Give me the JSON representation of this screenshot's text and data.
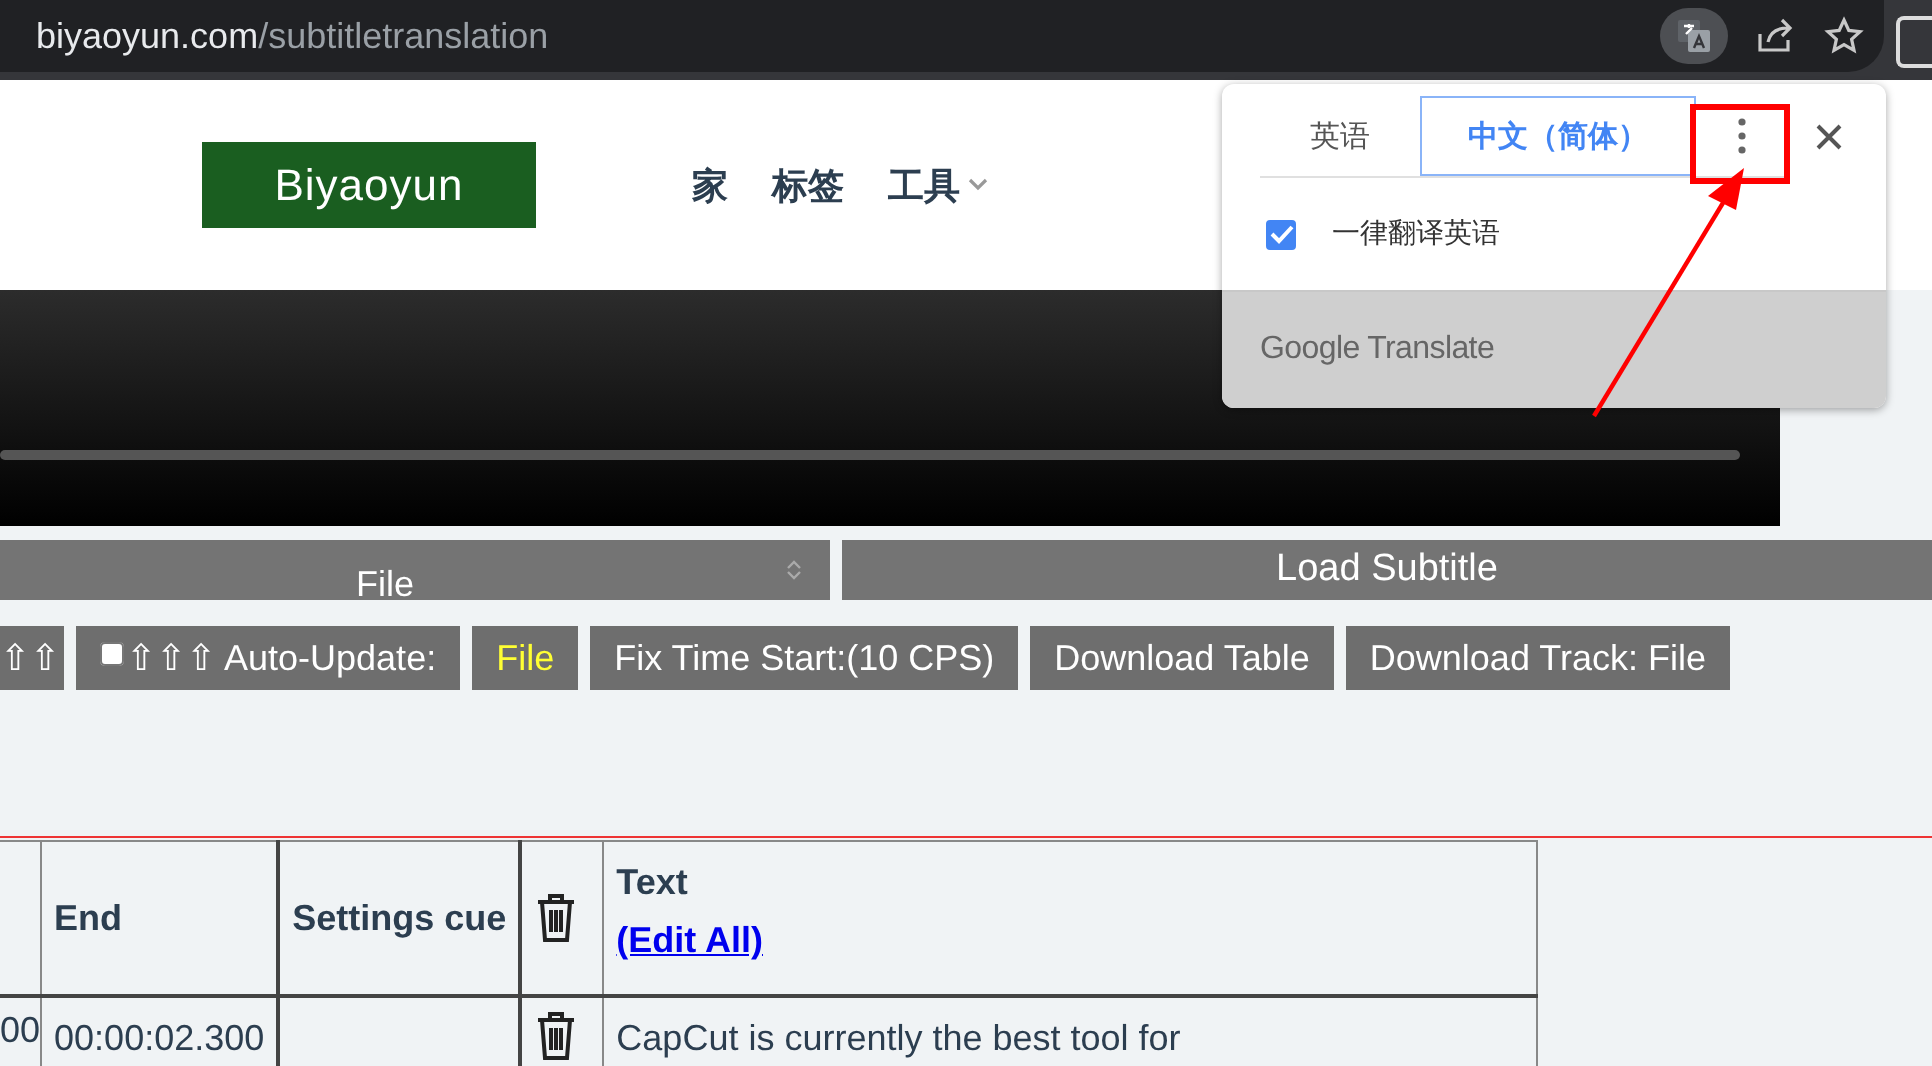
{
  "browser": {
    "address_domain": "biyaoyun.com",
    "address_path": "/subtitletranslation"
  },
  "site": {
    "logo": "Biyaoyun",
    "nav": [
      {
        "label": "家",
        "dropdown": false
      },
      {
        "label": "标签",
        "dropdown": false
      },
      {
        "label": "工具",
        "dropdown": true
      }
    ]
  },
  "file_select": {
    "value": "File"
  },
  "load_button": "Load Subtitle",
  "toolbar": [
    {
      "kind": "button",
      "label": "⇧⇧"
    },
    {
      "kind": "checkbox",
      "label": "⇧⇧⇧ Auto-Update:",
      "checked": false
    },
    {
      "kind": "accent",
      "label": "File"
    },
    {
      "kind": "button",
      "label": "Fix Time Start:(10 CPS)"
    },
    {
      "kind": "button",
      "label": "Download Table"
    },
    {
      "kind": "button",
      "label": "Download Track: File"
    }
  ],
  "table": {
    "columns": [
      {
        "kind": "cut"
      },
      {
        "kind": "text",
        "label": "End"
      },
      {
        "kind": "text",
        "label": "Settings cue"
      },
      {
        "kind": "delete"
      },
      {
        "kind": "text",
        "label": "Text",
        "link": "(Edit All)"
      }
    ],
    "rows": [
      {
        "column_1": "00",
        "end": "00:00:02.300",
        "text": "CapCut is currently the best tool for"
      }
    ]
  },
  "translate_popup": {
    "tabs": [
      {
        "label": "英语",
        "selected": false
      },
      {
        "label": "中文（简体）",
        "selected": true
      }
    ],
    "always_translate": {
      "label": "一律翻译英语",
      "checked": true
    },
    "footer": "Google Translate"
  }
}
